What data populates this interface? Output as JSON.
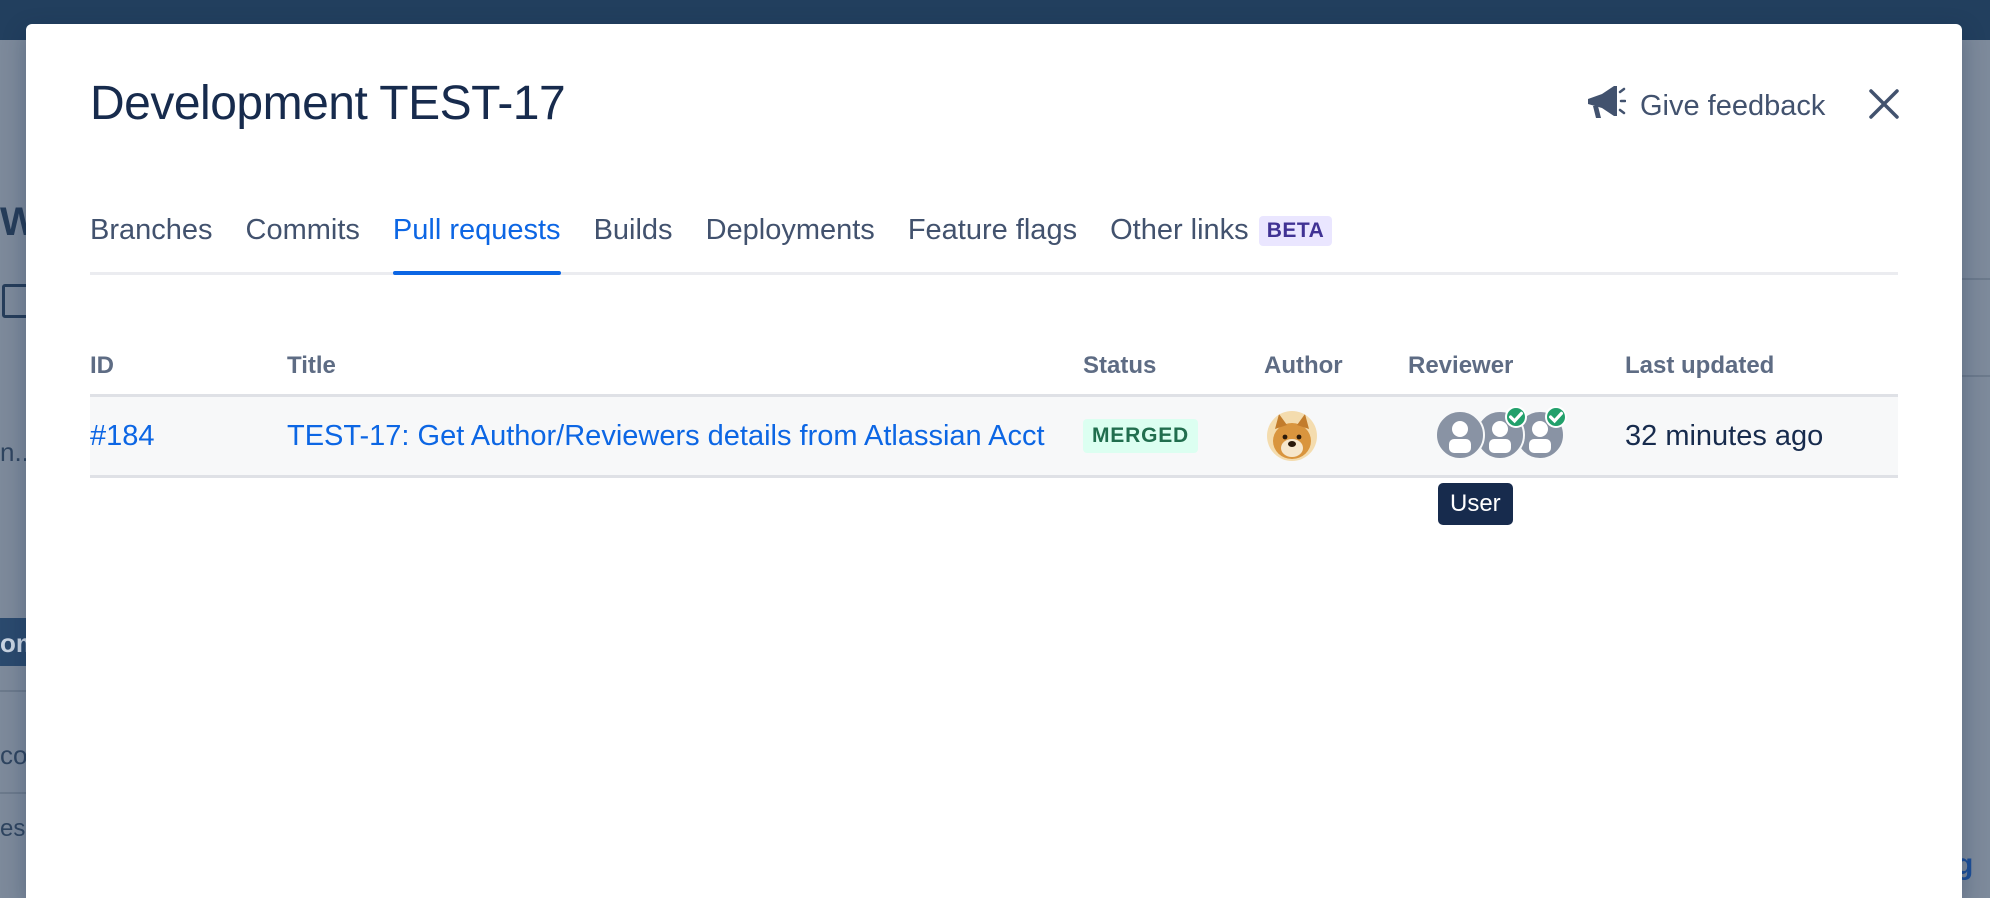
{
  "background": {
    "left_fragments": [
      "W",
      "n...",
      "om",
      "co",
      "ess"
    ],
    "right_fragments": [
      "g"
    ]
  },
  "modal": {
    "title": "Development TEST-17",
    "feedback_label": "Give feedback",
    "close_icon": "close-icon",
    "feedback_icon": "megaphone-icon"
  },
  "tabs": [
    {
      "label": "Branches",
      "active": false
    },
    {
      "label": "Commits",
      "active": false
    },
    {
      "label": "Pull requests",
      "active": true
    },
    {
      "label": "Builds",
      "active": false
    },
    {
      "label": "Deployments",
      "active": false
    },
    {
      "label": "Feature flags",
      "active": false
    },
    {
      "label": "Other links",
      "active": false,
      "badge": "BETA"
    }
  ],
  "table": {
    "headers": {
      "id": "ID",
      "title": "Title",
      "status": "Status",
      "author": "Author",
      "reviewer": "Reviewer",
      "last_updated": "Last updated"
    },
    "rows": [
      {
        "id": "#184",
        "title": "TEST-17: Get Author/Reviewers details from Atlassian Acct",
        "status": "MERGED",
        "author_avatar": "doge-avatar",
        "reviewers": [
          {
            "icon": "user-placeholder-icon",
            "approved": false
          },
          {
            "icon": "user-placeholder-icon",
            "approved": true
          },
          {
            "icon": "user-placeholder-icon",
            "approved": true
          }
        ],
        "last_updated": "32 minutes ago"
      }
    ]
  },
  "tooltip": "User",
  "colors": {
    "link": "#0c66e4",
    "merged_bg": "#dcfff1",
    "merged_text": "#216e4e",
    "approved": "#22a06b",
    "tooltip_bg": "#172b4d",
    "beta_bg": "#eae6ff"
  }
}
